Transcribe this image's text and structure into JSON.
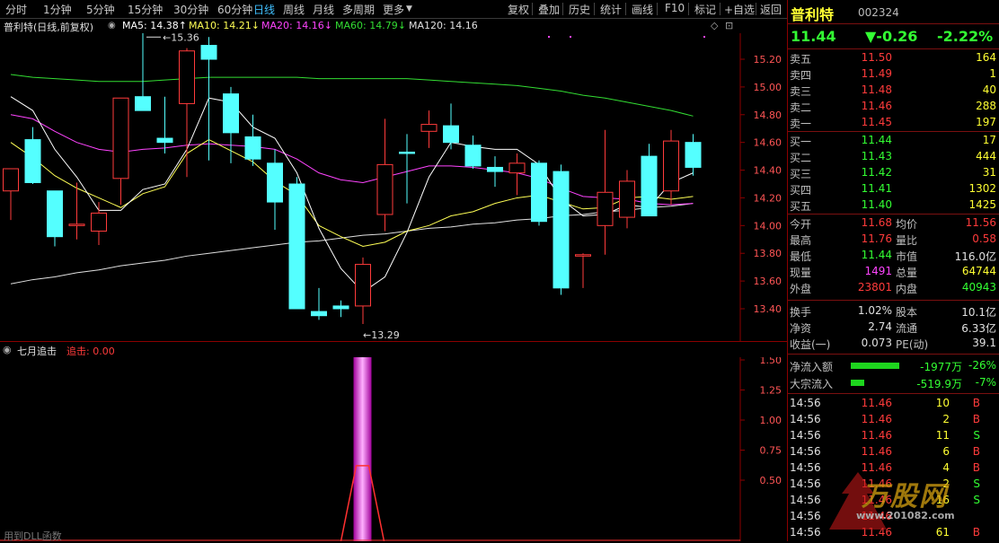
{
  "toolbar": {
    "periods": [
      "分时",
      "1分钟",
      "5分钟",
      "15分钟",
      "30分钟",
      "60分钟",
      "日线",
      "周线",
      "月线",
      "多周期",
      "更多"
    ],
    "active": "日线",
    "right_buttons": [
      "复权",
      "叠加",
      "历史",
      "统计",
      "画线",
      "F10",
      "标记",
      "+自选",
      "返回"
    ]
  },
  "chart_header": {
    "stock_label": "普利特(日线,前复权)",
    "ma5": "MA5: 14.38↑",
    "ma10": "MA10: 14.21↓",
    "ma20": "MA20: 14.16↓",
    "ma60": "MA60: 14.79↓",
    "ma120": "MA120: 14.16"
  },
  "price_axis": [
    "15.20",
    "15.00",
    "14.80",
    "14.60",
    "14.40",
    "14.20",
    "14.00",
    "13.80",
    "13.60",
    "13.40"
  ],
  "annotations": {
    "high": "15.36",
    "low": "13.29"
  },
  "indicator": {
    "name": "七月追击",
    "line_label": "追击: 0.00",
    "footer": "用到DLL函数",
    "axis": [
      "1.50",
      "1.25",
      "1.00",
      "0.75",
      "0.50"
    ]
  },
  "colors": {
    "up": "#ff3b3b",
    "down": "#54ffff",
    "ma5": "#ffffff",
    "ma10": "#ffff55",
    "ma20": "#ff44ff",
    "ma60": "#33dd33",
    "ma120": "#e0e0e0"
  },
  "chart_data": {
    "type": "candlestick",
    "ylim": [
      13.3,
      15.4
    ],
    "candles": [
      {
        "o": 14.25,
        "h": 14.41,
        "l": 14.04,
        "c": 14.41
      },
      {
        "o": 14.62,
        "h": 14.71,
        "l": 14.3,
        "c": 14.31
      },
      {
        "o": 14.25,
        "h": 14.25,
        "l": 13.85,
        "c": 13.92
      },
      {
        "o": 14.0,
        "h": 14.31,
        "l": 13.9,
        "c": 14.01
      },
      {
        "o": 13.96,
        "h": 14.17,
        "l": 13.86,
        "c": 14.09
      },
      {
        "o": 14.34,
        "h": 14.92,
        "l": 14.15,
        "c": 14.92
      },
      {
        "o": 14.93,
        "h": 15.41,
        "l": 14.83,
        "c": 14.83
      },
      {
        "o": 14.63,
        "h": 14.93,
        "l": 14.52,
        "c": 14.6
      },
      {
        "o": 14.88,
        "h": 15.28,
        "l": 14.35,
        "c": 15.26
      },
      {
        "o": 15.3,
        "h": 15.36,
        "l": 14.47,
        "c": 15.2
      },
      {
        "o": 14.95,
        "h": 15.0,
        "l": 14.45,
        "c": 14.67
      },
      {
        "o": 14.64,
        "h": 14.8,
        "l": 14.43,
        "c": 14.48
      },
      {
        "o": 14.45,
        "h": 14.55,
        "l": 13.97,
        "c": 14.17
      },
      {
        "o": 14.3,
        "h": 14.35,
        "l": 13.4,
        "c": 13.4
      },
      {
        "o": 13.38,
        "h": 13.55,
        "l": 13.32,
        "c": 13.35
      },
      {
        "o": 13.42,
        "h": 13.46,
        "l": 13.34,
        "c": 13.4
      },
      {
        "o": 13.42,
        "h": 13.77,
        "l": 13.29,
        "c": 13.72
      },
      {
        "o": 14.08,
        "h": 14.77,
        "l": 13.96,
        "c": 14.44
      },
      {
        "o": 14.53,
        "h": 14.66,
        "l": 14.16,
        "c": 14.52
      },
      {
        "o": 14.68,
        "h": 14.83,
        "l": 14.56,
        "c": 14.73
      },
      {
        "o": 14.72,
        "h": 14.88,
        "l": 14.55,
        "c": 14.6
      },
      {
        "o": 14.58,
        "h": 14.65,
        "l": 14.41,
        "c": 14.43
      },
      {
        "o": 14.42,
        "h": 14.5,
        "l": 14.28,
        "c": 14.39
      },
      {
        "o": 14.38,
        "h": 14.52,
        "l": 14.22,
        "c": 14.45
      },
      {
        "o": 14.45,
        "h": 14.47,
        "l": 14.0,
        "c": 14.03
      },
      {
        "o": 14.39,
        "h": 14.44,
        "l": 13.5,
        "c": 13.55
      },
      {
        "o": 13.78,
        "h": 13.8,
        "l": 13.55,
        "c": 13.79
      },
      {
        "o": 14.0,
        "h": 14.69,
        "l": 13.79,
        "c": 14.24
      },
      {
        "o": 14.06,
        "h": 14.4,
        "l": 13.98,
        "c": 14.32
      },
      {
        "o": 14.5,
        "h": 14.59,
        "l": 14.09,
        "c": 14.07
      },
      {
        "o": 14.25,
        "h": 14.69,
        "l": 14.15,
        "c": 14.61
      },
      {
        "o": 14.6,
        "h": 14.66,
        "l": 14.36,
        "c": 14.42
      }
    ],
    "ma5": [
      14.93,
      14.83,
      14.55,
      14.35,
      14.11,
      14.11,
      14.26,
      14.3,
      14.55,
      14.92,
      14.89,
      14.71,
      14.63,
      14.38,
      13.98,
      13.69,
      13.52,
      13.63,
      13.95,
      14.35,
      14.6,
      14.57,
      14.55,
      14.55,
      14.44,
      14.19,
      14.07,
      14.08,
      14.15,
      14.13,
      14.31,
      14.38
    ],
    "ma10": [
      14.6,
      14.49,
      14.36,
      14.27,
      14.2,
      14.13,
      14.23,
      14.28,
      14.52,
      14.62,
      14.54,
      14.46,
      14.32,
      14.22,
      14.0,
      13.92,
      13.85,
      13.88,
      13.96,
      14.0,
      14.07,
      14.1,
      14.16,
      14.2,
      14.22,
      14.17,
      14.12,
      14.13,
      14.2,
      14.21,
      14.19,
      14.21
    ],
    "ma20": [
      14.8,
      14.77,
      14.68,
      14.6,
      14.55,
      14.53,
      14.55,
      14.56,
      14.58,
      14.59,
      14.58,
      14.57,
      14.55,
      14.48,
      14.38,
      14.33,
      14.31,
      14.35,
      14.39,
      14.43,
      14.43,
      14.42,
      14.4,
      14.38,
      14.34,
      14.27,
      14.21,
      14.2,
      14.19,
      14.16,
      14.15,
      14.16
    ],
    "ma60": [
      15.09,
      15.07,
      15.06,
      15.05,
      15.04,
      15.04,
      15.04,
      15.05,
      15.06,
      15.07,
      15.07,
      15.07,
      15.07,
      15.07,
      15.06,
      15.06,
      15.06,
      15.06,
      15.06,
      15.05,
      15.04,
      15.03,
      15.02,
      15.01,
      14.99,
      14.97,
      14.94,
      14.92,
      14.89,
      14.86,
      14.83,
      14.79
    ],
    "ma120": [
      13.58,
      13.61,
      13.63,
      13.66,
      13.68,
      13.71,
      13.73,
      13.75,
      13.78,
      13.8,
      13.82,
      13.84,
      13.86,
      13.88,
      13.89,
      13.91,
      13.93,
      13.94,
      13.96,
      13.98,
      13.99,
      14.01,
      14.02,
      14.04,
      14.05,
      14.07,
      14.08,
      14.1,
      14.11,
      14.13,
      14.14,
      14.16
    ],
    "indicator_values": [
      0,
      0,
      0,
      0,
      0,
      0,
      0,
      0,
      0,
      0,
      0,
      0,
      0,
      0,
      0,
      0,
      1.58,
      0,
      0,
      0,
      0,
      0,
      0,
      0,
      0,
      0,
      0,
      0,
      0,
      0,
      0,
      0
    ],
    "indicator_ylim": [
      0.0,
      1.55
    ]
  },
  "panel": {
    "name": "普利特",
    "code": "002324",
    "price": "11.44",
    "change": "▼-0.26",
    "change_pct": "-2.22%",
    "sells": [
      {
        "label": "卖五",
        "price": "11.50",
        "vol": "164"
      },
      {
        "label": "卖四",
        "price": "11.49",
        "vol": "1"
      },
      {
        "label": "卖三",
        "price": "11.48",
        "vol": "40"
      },
      {
        "label": "卖二",
        "price": "11.46",
        "vol": "288"
      },
      {
        "label": "卖一",
        "price": "11.45",
        "vol": "197"
      }
    ],
    "buys": [
      {
        "label": "买一",
        "price": "11.44",
        "vol": "17"
      },
      {
        "label": "买二",
        "price": "11.43",
        "vol": "444"
      },
      {
        "label": "买三",
        "price": "11.42",
        "vol": "31"
      },
      {
        "label": "买四",
        "price": "11.41",
        "vol": "1302"
      },
      {
        "label": "买五",
        "price": "11.40",
        "vol": "1425"
      }
    ],
    "stats": [
      {
        "l1": "今开",
        "v1": "11.68",
        "l2": "均价",
        "v2": "11.56"
      },
      {
        "l1": "最高",
        "v1": "11.76",
        "l2": "量比",
        "v2": "0.58"
      },
      {
        "l1": "最低",
        "v1": "11.44",
        "l2": "市值",
        "v2": "116.0亿"
      },
      {
        "l1": "现量",
        "v1": "1491",
        "l2": "总量",
        "v2": "64744"
      },
      {
        "l1": "外盘",
        "v1": "23801",
        "l2": "内盘",
        "v2": "40943"
      }
    ],
    "stats2": [
      {
        "l1": "换手",
        "v1": "1.02%",
        "l2": "股本",
        "v2": "10.1亿"
      },
      {
        "l1": "净资",
        "v1": "2.74",
        "l2": "流通",
        "v2": "6.33亿"
      },
      {
        "l1": "收益(一)",
        "v1": "0.073",
        "l2": "PE(动)",
        "v2": "39.1"
      }
    ],
    "flows": [
      {
        "label": "净流入额",
        "value": "-1977万",
        "pct": "-26%",
        "bar": 1.0
      },
      {
        "label": "大宗流入",
        "value": "-519.9万",
        "pct": "-7%",
        "bar": 0.27
      }
    ],
    "ticks": [
      {
        "time": "14:56",
        "price": "11.46",
        "vol": "10",
        "side": "B"
      },
      {
        "time": "14:56",
        "price": "11.46",
        "vol": "2",
        "side": "B"
      },
      {
        "time": "14:56",
        "price": "11.46",
        "vol": "11",
        "side": "S"
      },
      {
        "time": "14:56",
        "price": "11.46",
        "vol": "6",
        "side": "B"
      },
      {
        "time": "14:56",
        "price": "11.46",
        "vol": "4",
        "side": "B"
      },
      {
        "time": "14:56",
        "price": "11.46",
        "vol": "2",
        "side": "S"
      },
      {
        "time": "14:56",
        "price": "11.46",
        "vol": "16",
        "side": "S"
      },
      {
        "time": "14:56",
        "price": "11.46",
        "vol": "",
        "side": ""
      },
      {
        "time": "14:56",
        "price": "11.46",
        "vol": "61",
        "side": "B"
      }
    ],
    "watermark": "万股网 www.201082.com"
  }
}
